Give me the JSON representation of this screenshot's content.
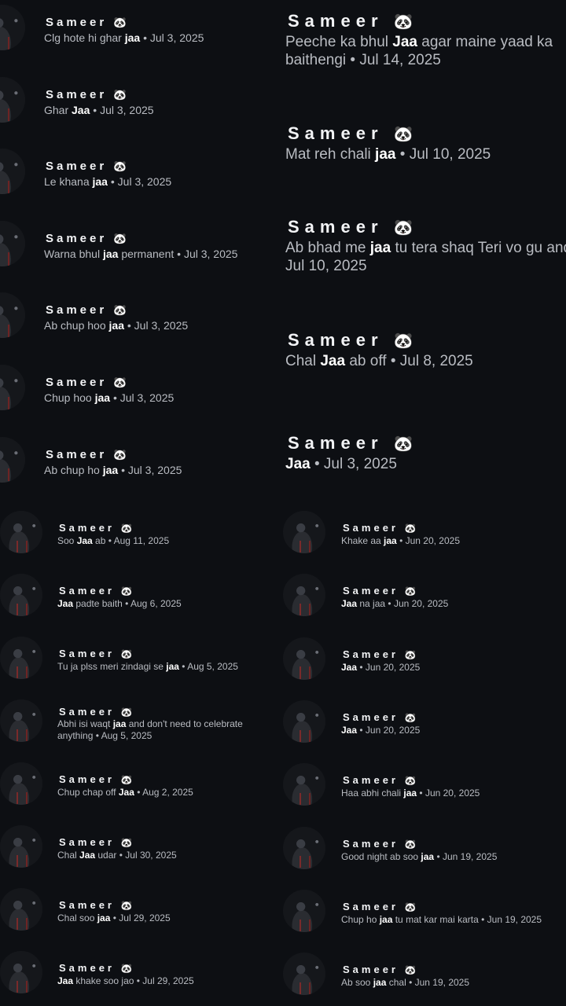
{
  "sender": "Sameer",
  "emoji": "🐼",
  "top_left": [
    {
      "before": "Clg hote hi ghar ",
      "kw": "jaa",
      "after": "",
      "date": "Jul 3, 2025"
    },
    {
      "before": "Ghar ",
      "kw": "Jaa",
      "after": "",
      "date": "Jul 3, 2025"
    },
    {
      "before": "Le khana ",
      "kw": "jaa",
      "after": "",
      "date": "Jul 3, 2025"
    },
    {
      "before": "Warna bhul ",
      "kw": "jaa",
      "after": " permanent",
      "date": "Jul 3, 2025"
    },
    {
      "before": "Ab chup hoo ",
      "kw": "jaa",
      "after": "",
      "date": "Jul 3, 2025"
    },
    {
      "before": "Chup hoo ",
      "kw": "jaa",
      "after": "",
      "date": "Jul 3, 2025"
    },
    {
      "before": "Ab chup ho ",
      "kw": "jaa",
      "after": "",
      "date": "Jul 3, 2025"
    }
  ],
  "top_right": [
    {
      "before": "Peeche ka bhul ",
      "kw": "Jaa",
      "after": " agar maine yaad ka baithengi",
      "date": "Jul 14, 2025"
    },
    {
      "before": "Mat reh chali ",
      "kw": "jaa",
      "after": "",
      "date": "Jul 10, 2025"
    },
    {
      "before": "Ab bhad me ",
      "kw": "jaa",
      "after": " tu tera shaq Teri vo gu and all",
      "date": "Jul 10, 2025"
    },
    {
      "before": "Chal ",
      "kw": "Jaa",
      "after": " ab off",
      "date": "Jul 8, 2025"
    },
    {
      "before": "",
      "kw": "Jaa",
      "after": "",
      "date": "Jul 3, 2025"
    }
  ],
  "bottom_left": [
    {
      "before": "Soo ",
      "kw": "Jaa",
      "after": " ab",
      "date": "Aug 11, 2025"
    },
    {
      "before": "",
      "kw": "Jaa",
      "after": " padte baith",
      "date": "Aug 6, 2025"
    },
    {
      "before": "Tu ja plss meri zindagi se ",
      "kw": "jaa",
      "after": "",
      "date": "Aug 5, 2025"
    },
    {
      "before": "Abhi isi waqt ",
      "kw": "jaa",
      "after": " and don't need to celebrate anything",
      "date": "Aug 5, 2025"
    },
    {
      "before": "Chup chap off ",
      "kw": "Jaa",
      "after": "",
      "date": "Aug 2, 2025"
    },
    {
      "before": "Chal ",
      "kw": "Jaa",
      "after": " udar",
      "date": "Jul 30, 2025"
    },
    {
      "before": "Chal soo ",
      "kw": "jaa",
      "after": "",
      "date": "Jul 29, 2025"
    },
    {
      "before": "",
      "kw": "Jaa",
      "after": " khake soo jao",
      "date": "Jul 29, 2025"
    }
  ],
  "bottom_right": [
    {
      "before": "Khake aa ",
      "kw": "jaa",
      "after": "",
      "date": "Jun 20, 2025"
    },
    {
      "before": "",
      "kw": "Jaa",
      "after": " na jaa",
      "date": "Jun 20, 2025"
    },
    {
      "before": "",
      "kw": "Jaa",
      "after": "",
      "date": "Jun 20, 2025"
    },
    {
      "before": "",
      "kw": "Jaa",
      "after": "",
      "date": "Jun 20, 2025"
    },
    {
      "before": "Haa abhi chali ",
      "kw": "jaa",
      "after": "",
      "date": "Jun 20, 2025"
    },
    {
      "before": "Good night ab soo ",
      "kw": "jaa",
      "after": "",
      "date": "Jun 19, 2025"
    },
    {
      "before": "Chup ho ",
      "kw": "jaa",
      "after": " tu mat kar mai karta",
      "date": "Jun 19, 2025"
    },
    {
      "before": "Ab soo ",
      "kw": "jaa",
      "after": " chal",
      "date": "Jun 19, 2025"
    }
  ]
}
